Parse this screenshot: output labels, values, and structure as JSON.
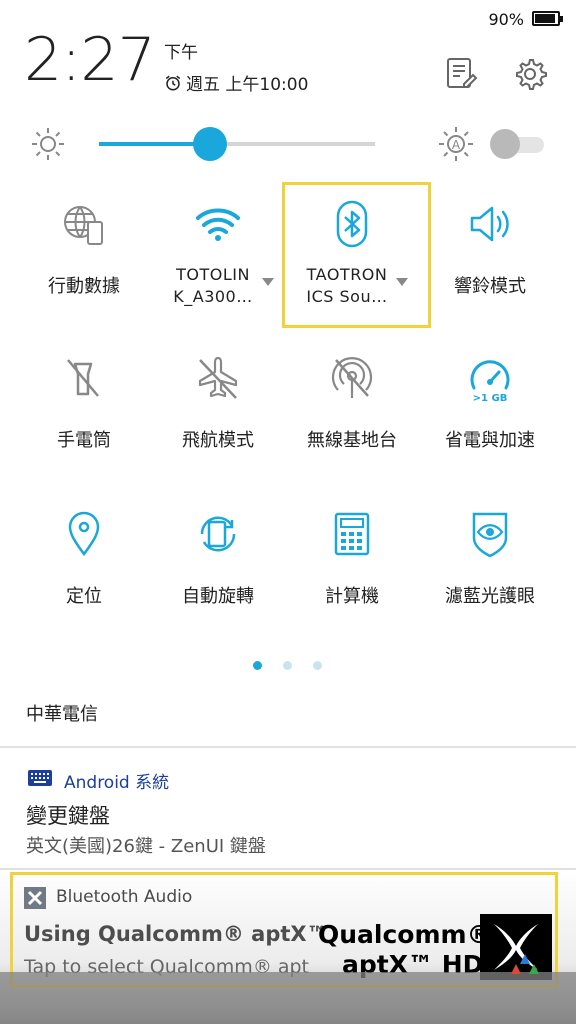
{
  "status": {
    "battery_percent": "90%"
  },
  "header": {
    "clock": "2:27",
    "ampm": "下午",
    "alarm": "週五 上午10:00"
  },
  "brightness": {
    "level": 0.4,
    "auto": false
  },
  "tiles": {
    "mobile_data": "行動數據",
    "wifi_line1": "TOTOLIN",
    "wifi_line2": "K_A300…",
    "bluetooth_line1": "TAOTRON",
    "bluetooth_line2": "ICS Sou…",
    "ring_mode": "響鈴模式",
    "flashlight": "手電筒",
    "airplane": "飛航模式",
    "hotspot": "無線基地台",
    "power_boost": "省電與加速",
    "power_boost_badge": ">1 GB",
    "location": "定位",
    "auto_rotate": "自動旋轉",
    "calculator": "計算機",
    "bluelight": "濾藍光護眼"
  },
  "carrier": "中華電信",
  "notification_keyboard": {
    "app": "Android 系統",
    "title": "變更鍵盤",
    "text": "英文(美國)26鍵 - ZenUI 鍵盤"
  },
  "notification_bt": {
    "app": "Bluetooth Audio",
    "title": "Using Qualcomm® aptX™ H",
    "subtitle": "Tap to select Qualcomm® apt",
    "logo_line1": "Qualcomm®",
    "logo_line2": "aptX™ HD"
  },
  "colors": {
    "accent": "#1aa7db",
    "highlight": "#f0d33a",
    "app_blue": "#1a3f9c"
  }
}
